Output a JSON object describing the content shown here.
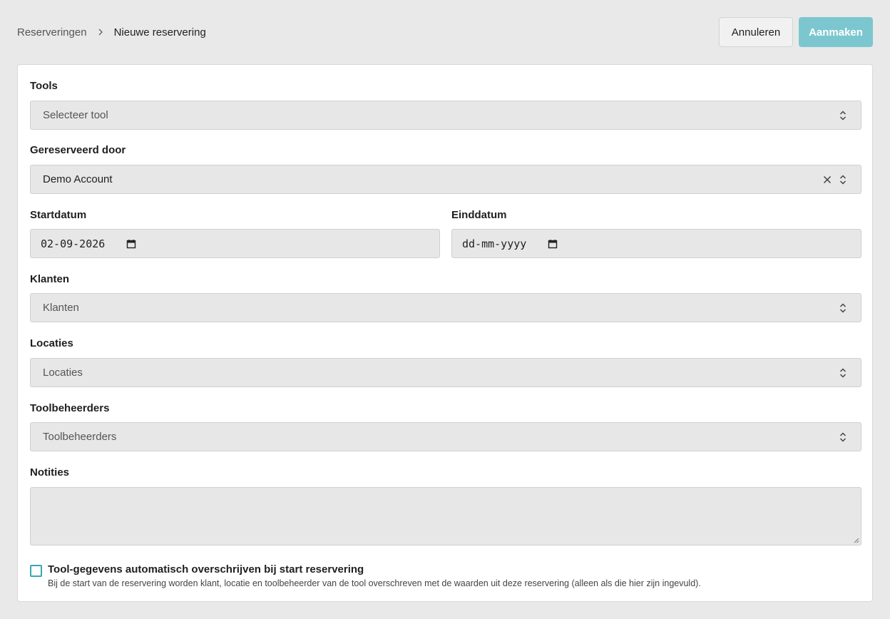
{
  "breadcrumb": {
    "parent": "Reserveringen",
    "current": "Nieuwe reservering"
  },
  "actions": {
    "cancel_label": "Annuleren",
    "create_label": "Aanmaken"
  },
  "form": {
    "tools": {
      "label": "Tools",
      "placeholder": "Selecteer tool"
    },
    "reserved_by": {
      "label": "Gereserveerd door",
      "value": "Demo Account"
    },
    "start_date": {
      "label": "Startdatum",
      "value": "02-09-2026"
    },
    "end_date": {
      "label": "Einddatum",
      "placeholder": "dd-mm-yyyy"
    },
    "clients": {
      "label": "Klanten",
      "placeholder": "Klanten"
    },
    "locations": {
      "label": "Locaties",
      "placeholder": "Locaties"
    },
    "tool_managers": {
      "label": "Toolbeheerders",
      "placeholder": "Toolbeheerders"
    },
    "notes": {
      "label": "Notities",
      "value": ""
    },
    "overwrite": {
      "label": "Tool-gegevens automatisch overschrijven bij start reservering",
      "description": "Bij de start van de reservering worden klant, locatie en toolbeheerder van de tool overschreven met de waarden uit deze reservering (alleen als die hier zijn ingevuld).",
      "checked": false
    }
  },
  "colors": {
    "accent": "#3aa7b3",
    "create_button": "#7cc7cf"
  }
}
